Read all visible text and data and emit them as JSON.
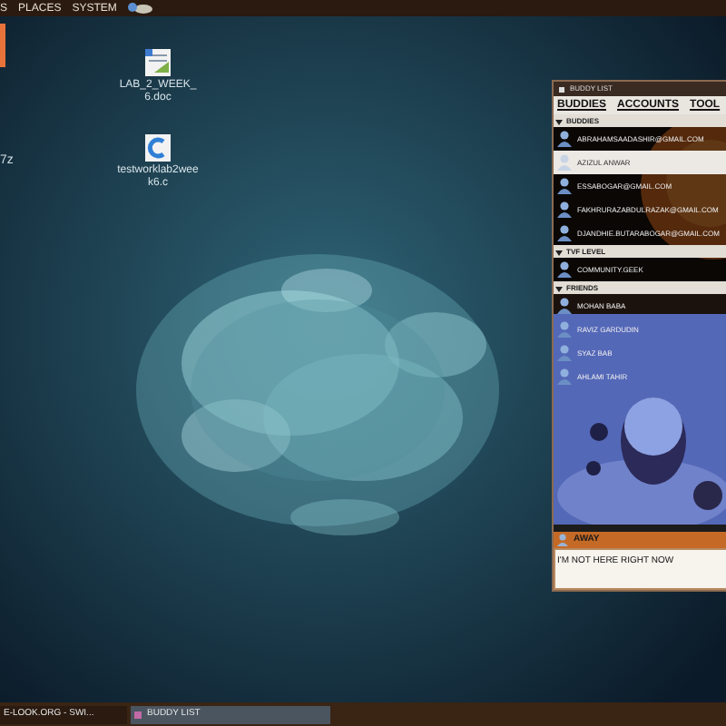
{
  "top_panel": {
    "menus": [
      "S",
      "PLACES",
      "SYSTEM"
    ]
  },
  "desktop_icons": [
    {
      "kind": "document",
      "label": "LAB_2_WEEK_6.doc"
    },
    {
      "kind": "c-source",
      "label": "testworklab2week6.c"
    }
  ],
  "left_edge_label": "7z",
  "buddy_list": {
    "title": "BUDDY LIST",
    "menus": [
      "BUDDIES",
      "ACCOUNTS",
      "TOOL"
    ],
    "groups": [
      {
        "name": "BUDDIES",
        "expanded": true,
        "buddies": [
          {
            "name": "ABRAHAMSAADASHIR@GMAIL.COM",
            "selected": false
          },
          {
            "name": "AZIZUL ANWAR",
            "selected": true
          },
          {
            "name": "ESSABOGAR@GMAIL.COM",
            "selected": false
          },
          {
            "name": "FAKHRURAZABDULRAZAK@GMAIL.COM",
            "selected": false
          },
          {
            "name": "DJANDHIE.BUTARABOGAR@GMAIL.COM",
            "selected": false
          }
        ]
      },
      {
        "name": "TVF LEVEL",
        "expanded": true,
        "buddies": [
          {
            "name": "COMMUNITY.GEEK",
            "selected": false
          }
        ]
      },
      {
        "name": "FRIENDS",
        "expanded": true,
        "buddies": [
          {
            "name": "MOHAN BABA",
            "selected": false
          },
          {
            "name": "RAVIZ GARDUDIN",
            "selected": false
          },
          {
            "name": "SYAZ BAB",
            "selected": false
          },
          {
            "name": "AHLAMI TAHIR",
            "selected": false
          }
        ]
      }
    ],
    "status": "AWAY",
    "message": "I'M NOT HERE RIGHT NOW"
  },
  "taskbar": [
    {
      "label": "E-LOOK.ORG - SWI...",
      "selected": false
    },
    {
      "label": "BUDDY LIST",
      "selected": true
    }
  ]
}
